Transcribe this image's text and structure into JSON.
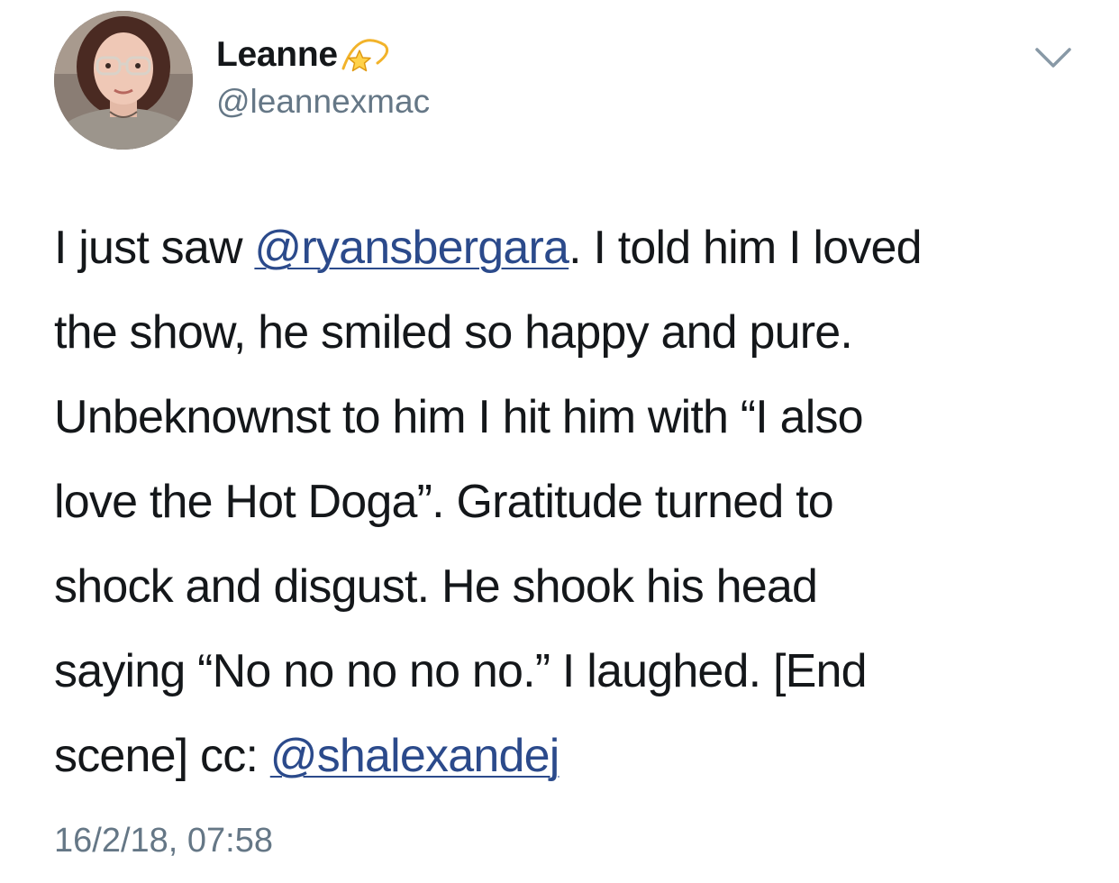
{
  "user": {
    "display_name": "Leanne",
    "name_emoji": "dizzy-star-icon",
    "handle": "@leannexmac"
  },
  "tweet": {
    "lines": [
      {
        "segments": [
          {
            "text": "I just saw "
          },
          {
            "text": "@ryansbergara",
            "mention": true
          },
          {
            "text": ". I told him I loved"
          }
        ]
      },
      {
        "segments": [
          {
            "text": "the show, he smiled so happy and pure."
          }
        ]
      },
      {
        "segments": [
          {
            "text": "Unbeknownst to him I hit him with “I also"
          }
        ]
      },
      {
        "segments": [
          {
            "text": "love the Hot Doga”. Gratitude turned to"
          }
        ]
      },
      {
        "segments": [
          {
            "text": "shock and disgust. He shook his head"
          }
        ]
      },
      {
        "segments": [
          {
            "text": "saying “No no no no no.” I laughed. [End"
          }
        ]
      },
      {
        "segments": [
          {
            "text": "scene] cc: "
          },
          {
            "text": "@shalexandej",
            "mention": true
          }
        ]
      }
    ],
    "timestamp": "16/2/18, 07:58"
  },
  "colors": {
    "text": "#14171a",
    "secondary": "#657786",
    "mention": "#2b4a8b",
    "background": "#ffffff"
  }
}
